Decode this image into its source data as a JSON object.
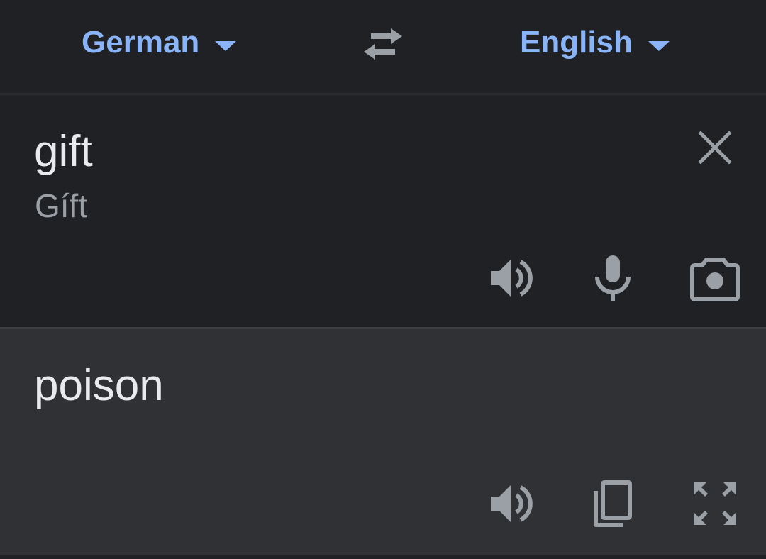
{
  "header": {
    "source_language": "German",
    "target_language": "English",
    "swap_icon": "swap-horiz-icon"
  },
  "input": {
    "text": "gift",
    "transliteration": "Gíft",
    "icons": [
      "close-icon",
      "speaker-icon",
      "mic-icon",
      "camera-icon"
    ]
  },
  "output": {
    "text": "poison",
    "icons": [
      "speaker-icon",
      "copy-icon",
      "fullscreen-icon"
    ]
  },
  "colors": {
    "accent": "#8ab4f8",
    "icon": "#9aa0a6",
    "text": "#e8eaed",
    "background": "#202124",
    "output_background": "#303134"
  }
}
